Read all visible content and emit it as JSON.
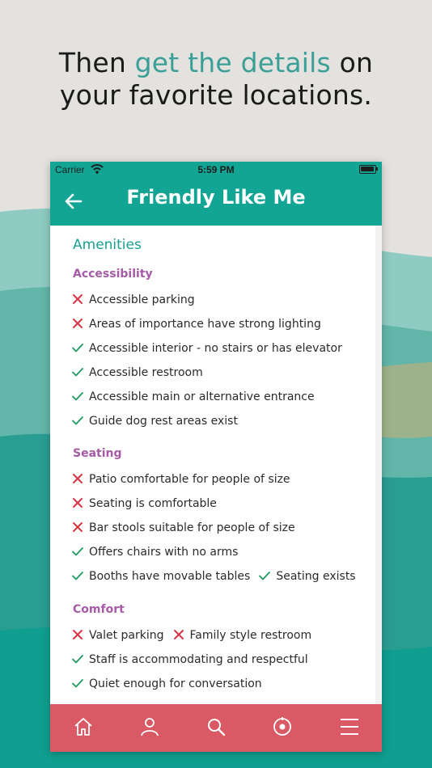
{
  "headline": {
    "pre": "Then ",
    "accent": "get the details",
    "post_line1": " on",
    "line2": "your favorite locations."
  },
  "colors": {
    "accent_teal": "#12a594",
    "headline_accent": "#3a9f96",
    "category": "#a65aa7",
    "no_mark": "#d93344",
    "yes_mark": "#1f9a60",
    "tabbar": "#d95a65"
  },
  "status_bar": {
    "carrier": "Carrier",
    "time": "5:59 PM"
  },
  "header": {
    "title": "Friendly Like Me",
    "back_icon": "arrow-left-icon"
  },
  "amenities": {
    "title": "Amenities",
    "accessibility": {
      "label": "Accessibility",
      "items": [
        {
          "text": "Accessible parking",
          "available": false
        },
        {
          "text": "Areas of importance have strong lighting",
          "available": false
        },
        {
          "text": "Accessible interior - no stairs or has elevator",
          "available": true
        },
        {
          "text": "Accessible restroom",
          "available": true
        },
        {
          "text": "Accessible main or alternative entrance",
          "available": true
        },
        {
          "text": "Guide dog rest areas exist",
          "available": true
        }
      ]
    },
    "seating": {
      "label": "Seating",
      "items": [
        {
          "text": "Patio comfortable for people of size",
          "available": false
        },
        {
          "text": "Seating is comfortable",
          "available": false
        },
        {
          "text": "Bar stools suitable for people of size",
          "available": false
        },
        {
          "text": "Offers chairs with no arms",
          "available": true
        },
        {
          "text": "Booths have movable tables",
          "available": true
        },
        {
          "text": "Seating exists",
          "available": true
        }
      ]
    },
    "comfort": {
      "label": "Comfort",
      "items": [
        {
          "text": "Valet parking",
          "available": false
        },
        {
          "text": "Family style restroom",
          "available": false
        },
        {
          "text": "Staff is accommodating and respectful",
          "available": true
        },
        {
          "text": "Quiet enough for conversation",
          "available": true
        }
      ]
    }
  },
  "tabbar": {
    "icons": [
      "home-icon",
      "profile-icon",
      "search-icon",
      "location-icon",
      "menu-icon"
    ]
  }
}
